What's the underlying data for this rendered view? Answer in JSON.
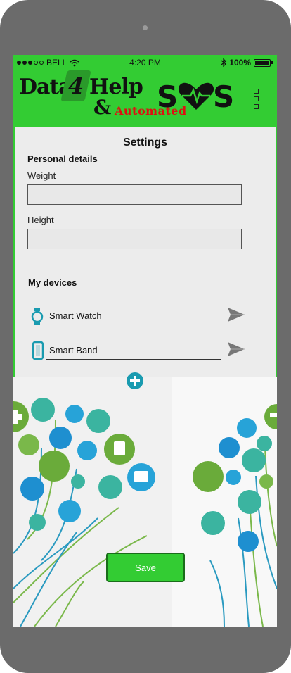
{
  "status_bar": {
    "carrier": "BELL",
    "time": "4:20 PM",
    "battery": "100%",
    "wifi_icon": "wifi-icon",
    "bluetooth_icon": "bluetooth-icon"
  },
  "header": {
    "logo_data": "Data",
    "logo_four": "4",
    "logo_help": "Help",
    "logo_amp": "&",
    "logo_automated": "Automated",
    "sos_letters": "SOS",
    "menu_icon": "menu-icon"
  },
  "settings": {
    "title": "Settings",
    "personal_details": "Personal details",
    "weight_label": "Weight",
    "weight_value": "",
    "height_label": "Height",
    "height_value": "",
    "my_devices": "My devices",
    "devices": [
      {
        "name": "Smart Watch",
        "icon": "smartwatch-icon",
        "action_icon": "send-icon"
      },
      {
        "name": "Smart Band",
        "icon": "smartband-icon",
        "action_icon": "send-icon"
      }
    ],
    "add_device_icon": "plus-icon",
    "save_label": "Save"
  },
  "colors": {
    "brand_green": "#33cc33",
    "dark_green": "#1a6d1a",
    "accent_teal": "#1a9bb0",
    "logo_red": "#dd1111"
  }
}
